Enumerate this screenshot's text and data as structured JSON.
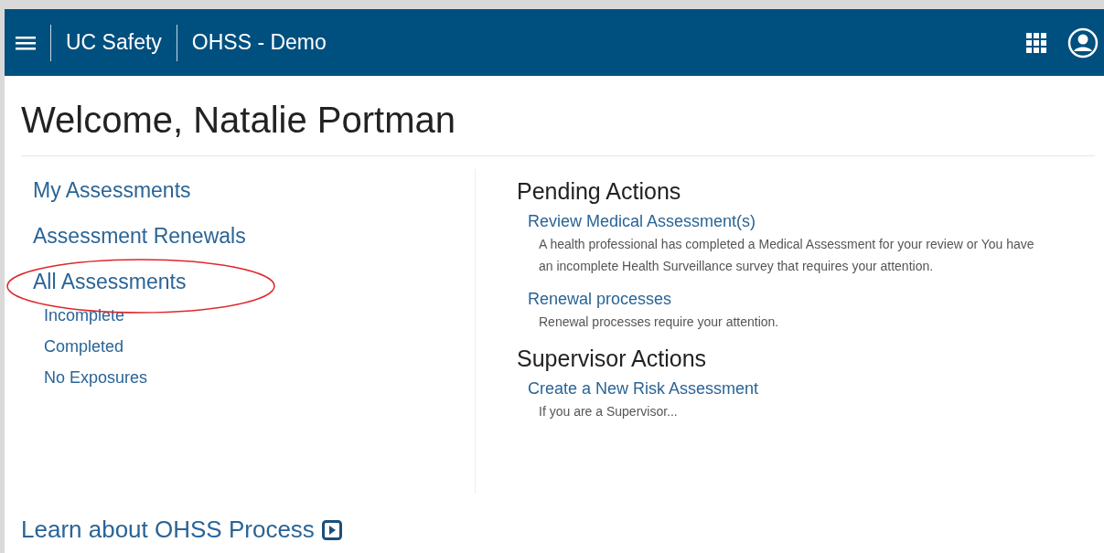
{
  "header": {
    "title": "UC Safety",
    "subtitle": "OHSS - Demo"
  },
  "welcome": "Welcome, Natalie Portman",
  "assessment_links": [
    {
      "label": "My Assessments",
      "circled": false
    },
    {
      "label": "Assessment Renewals",
      "circled": false
    },
    {
      "label": "All Assessments",
      "circled": true,
      "children": [
        {
          "label": "Incomplete"
        },
        {
          "label": "Completed"
        },
        {
          "label": "No Exposures"
        }
      ]
    }
  ],
  "action_sections": [
    {
      "heading": "Pending Actions",
      "items": [
        {
          "link": "Review Medical Assessment(s)",
          "description": "A health professional has completed a Medical Assessment for your review or You have an incomplete Health Surveillance survey that requires your attention."
        },
        {
          "link": "Renewal processes",
          "description": "Renewal processes require your attention."
        }
      ]
    },
    {
      "heading": "Supervisor Actions",
      "items": [
        {
          "link": "Create a New Risk Assessment",
          "description": "If you are a Supervisor..."
        }
      ]
    }
  ],
  "footer_link": "Learn about OHSS Process"
}
